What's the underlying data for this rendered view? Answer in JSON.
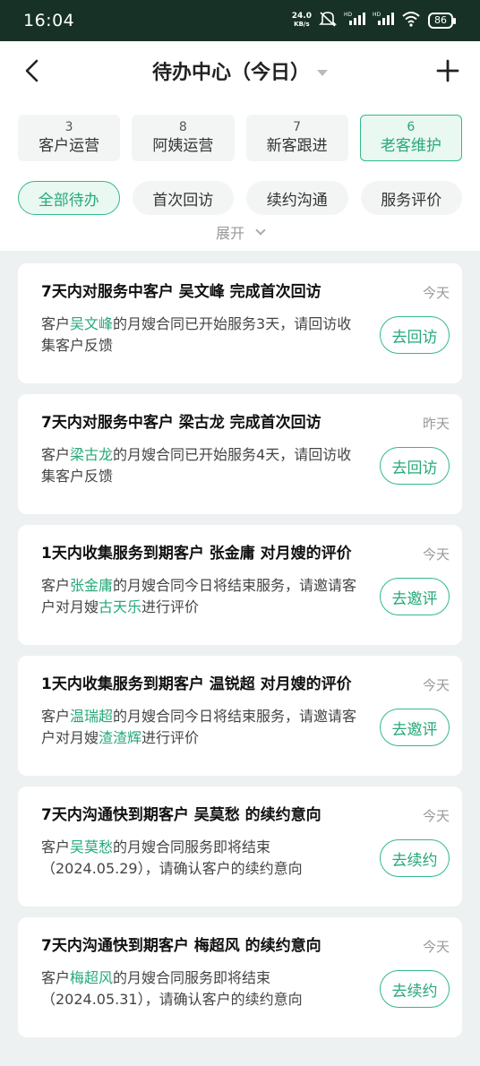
{
  "status_bar": {
    "time": "16:04",
    "net_speed_value": "24.0",
    "net_speed_unit": "KB/s",
    "battery": "86",
    "icons": [
      "mute-icon",
      "signal-hd-icon",
      "signal-hd-icon",
      "wifi-icon"
    ]
  },
  "nav": {
    "title": "待办中心（今日）",
    "back_icon": "back-arrow-icon",
    "add_icon": "plus-icon"
  },
  "categories": [
    {
      "count": "3",
      "label": "客户运营",
      "active": false
    },
    {
      "count": "8",
      "label": "阿姨运营",
      "active": false
    },
    {
      "count": "7",
      "label": "新客跟进",
      "active": false
    },
    {
      "count": "6",
      "label": "老客维护",
      "active": true
    }
  ],
  "filters": [
    {
      "label": "全部待办",
      "active": true
    },
    {
      "label": "首次回访",
      "active": false
    },
    {
      "label": "续约沟通",
      "active": false
    },
    {
      "label": "服务评价",
      "active": false
    }
  ],
  "expand_label": "展开",
  "tasks": [
    {
      "title": "7天内对服务中客户 吴文峰 完成首次回访",
      "date": "今天",
      "desc_parts": [
        {
          "text": "客户"
        },
        {
          "text": "吴文峰",
          "hl": true
        },
        {
          "text": "的月嫂合同已开始服务3天，请回访收集客户反馈"
        }
      ],
      "action": "去回访"
    },
    {
      "title": "7天内对服务中客户 梁古龙 完成首次回访",
      "date": "昨天",
      "desc_parts": [
        {
          "text": "客户"
        },
        {
          "text": "梁古龙",
          "hl": true
        },
        {
          "text": "的月嫂合同已开始服务4天，请回访收集客户反馈"
        }
      ],
      "action": "去回访"
    },
    {
      "title": "1天内收集服务到期客户 张金庸 对月嫂的评价",
      "date": "今天",
      "desc_parts": [
        {
          "text": "客户"
        },
        {
          "text": "张金庸",
          "hl": true
        },
        {
          "text": "的月嫂合同今日将结束服务，请邀请客户对月嫂"
        },
        {
          "text": "古天乐",
          "hl": true
        },
        {
          "text": "进行评价"
        }
      ],
      "action": "去邀评"
    },
    {
      "title": "1天内收集服务到期客户 温锐超 对月嫂的评价",
      "date": "今天",
      "desc_parts": [
        {
          "text": "客户"
        },
        {
          "text": "温瑞超",
          "hl": true
        },
        {
          "text": "的月嫂合同今日将结束服务，请邀请客户对月嫂"
        },
        {
          "text": "渣渣辉",
          "hl": true
        },
        {
          "text": "进行评价"
        }
      ],
      "action": "去邀评"
    },
    {
      "title": "7天内沟通快到期客户 吴莫愁 的续约意向",
      "date": "今天",
      "desc_parts": [
        {
          "text": "客户"
        },
        {
          "text": "吴莫愁",
          "hl": true
        },
        {
          "text": "的月嫂合同服务即将结束（2024.05.29），请确认客户的续约意向"
        }
      ],
      "action": "去续约"
    },
    {
      "title": "7天内沟通快到期客户 梅超风 的续约意向",
      "date": "今天",
      "desc_parts": [
        {
          "text": "客户"
        },
        {
          "text": "梅超风",
          "hl": true
        },
        {
          "text": "的月嫂合同服务即将结束（2024.05.31），请确认客户的续约意向"
        }
      ],
      "action": "去续约"
    }
  ],
  "colors": {
    "accent": "#26a978",
    "status_bar": "#173127",
    "page_bg": "#eef1f1"
  }
}
